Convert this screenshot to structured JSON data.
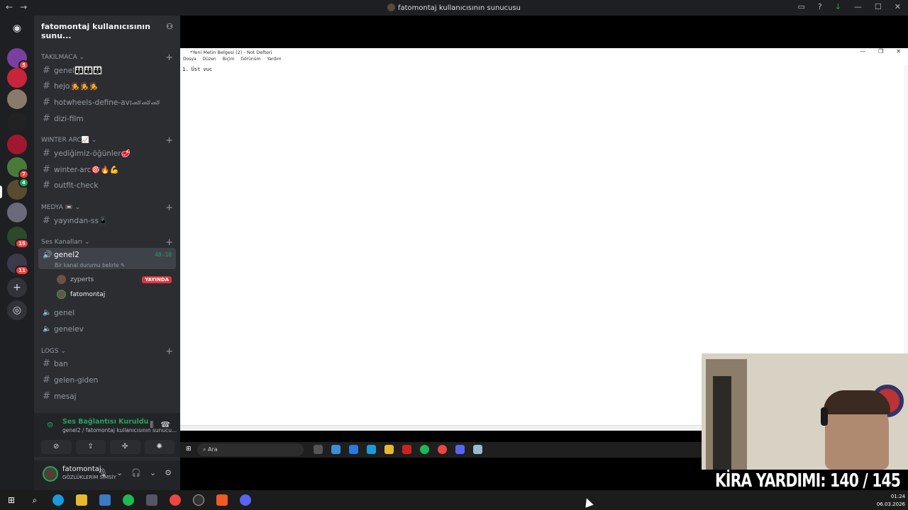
{
  "window": {
    "title": "fatomontaj kullanıcısının sunucusu",
    "back": "←",
    "forward": "→"
  },
  "server": {
    "name": "fatomontaj kullanıcısının sunu..."
  },
  "rail_badges": [
    "5",
    "7",
    "4",
    "15",
    "11"
  ],
  "categories": {
    "takilmaca": "TAKILMACA",
    "winter_arc": "WINTER ARC📈",
    "medya": "MEDYA 📼",
    "ses": "Ses Kanalları",
    "logs": "LOGS"
  },
  "channels": {
    "genel_text": "genel👨‍👩‍👦👨‍👩‍👦👨‍👩‍👦",
    "hejo": "hejo🧑‍🎤🧑‍🎤🧑‍🎤",
    "hotwheels": "hotwheels-define-avı🏎🏎🏎",
    "dizi_film": "dizi-film",
    "yedigimiz": "yediğimiz-öğünler🥩",
    "winter_arc": "winter-arc🎯🔥💪",
    "outfit": "outfit-check",
    "yayindan": "yayından-ss📱",
    "ban": "ban",
    "gelen_giden": "gelen-giden",
    "mesaj": "mesaj"
  },
  "voice": {
    "active_channel": "genel2",
    "time": "48:10",
    "status_sub": "Bir kanal durumu belirle",
    "users": [
      {
        "name": "zyperts",
        "live": "YAYINDA"
      },
      {
        "name": "fatomontaj",
        "live": ""
      }
    ],
    "other_channels": [
      "genel",
      "genelev"
    ]
  },
  "voice_panel": {
    "status": "Ses Bağlantısı Kuruldu",
    "sub": "genel2 / fatomontaj kullanıcısının sunucu..."
  },
  "user": {
    "name": "fatomontaj",
    "status": "GÖZLÜKLERİM SİMSİY"
  },
  "notepad": {
    "title": "*Yeni Metin Belgesi (2) - Not Defteri",
    "menu": [
      "Dosya",
      "Düzen",
      "Biçim",
      "Görünüm",
      "Yardım"
    ],
    "content": "1. Üst vuc"
  },
  "inner_taskbar": {
    "search": "Ara"
  },
  "overlay": {
    "text": "KİRA YARDIMI: 140 / 145"
  },
  "clock": {
    "time": "01:24",
    "date": "06.03.2026"
  },
  "colors": {
    "accent_green": "#23a55a",
    "live_red": "#da373c",
    "bg_dark": "#1e1f22",
    "sidebar": "#2b2d31"
  }
}
